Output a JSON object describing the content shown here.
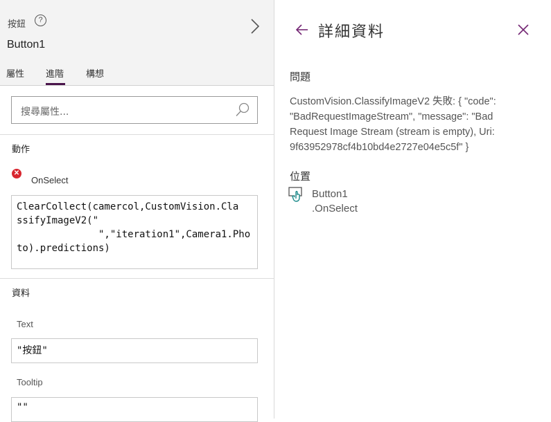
{
  "left_panel": {
    "control_type": "按鈕",
    "help_glyph": "?",
    "control_name": "Button1",
    "tabs": [
      {
        "label": "屬性",
        "active": false
      },
      {
        "label": "進階",
        "active": true
      },
      {
        "label": "構想",
        "active": false
      }
    ],
    "search": {
      "placeholder": "搜尋屬性..."
    },
    "actions": {
      "title": "動作",
      "error_glyph": "✕",
      "property": "OnSelect",
      "formula_lines": [
        "ClearCollect(camercol,CustomVision.Cla",
        "ssifyImageV2(\"",
        "              \",\"iteration1\",Camera1.Pho",
        "to).predictions)"
      ]
    },
    "data_section": {
      "title": "資料",
      "fields": [
        {
          "label": "Text",
          "value": "\"按鈕\""
        },
        {
          "label": "Tooltip",
          "value": "\"\""
        }
      ]
    }
  },
  "details_panel": {
    "title": "詳細資料",
    "issue_heading": "問題",
    "issue_lines": [
      "CustomVision.ClassifyImageV2 失敗: { \"code\":",
      "\"BadRequestImageStream\", \"message\": \"Bad",
      "Request Image Stream (stream is empty), Uri:",
      "9f63952978cf4b10bd4e2727e04e5c5f\" }"
    ],
    "location_heading": "位置",
    "location_control": "Button1",
    "location_property": ".OnSelect"
  },
  "colors": {
    "accent": "#742774",
    "error": "#d8262f",
    "header_bg": "#f3f3f3",
    "location_icon": "#1b8a8a"
  }
}
